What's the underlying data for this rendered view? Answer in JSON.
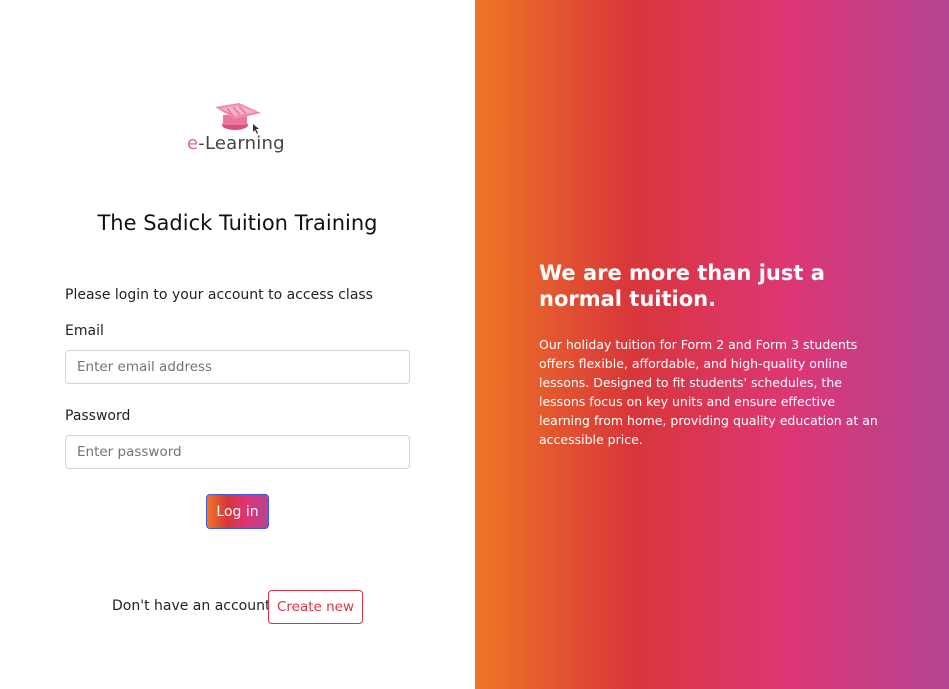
{
  "logo": {
    "prefix": "e",
    "suffix": "-Learning"
  },
  "title": "The Sadick Tuition Training",
  "login_form": {
    "subtitle": "Please login to your account to access class",
    "email_label": "Email",
    "email_placeholder": "Enter email address",
    "password_label": "Password",
    "password_placeholder": "Enter password",
    "login_button": "Log in"
  },
  "signup": {
    "prompt": "Don't have an account?",
    "create_button": "Create new"
  },
  "promo": {
    "headline": "We are more than just a normal tuition.",
    "body": "Our holiday tuition for Form 2 and Form 3 students offers flexible, affordable, and high-quality online lessons. Designed to fit students' schedules, the lessons focus on key units and ensure effective learning from home, providing quality education at an accessible price."
  },
  "colors": {
    "gradient": [
      "#ee7724",
      "#d8363a",
      "#dd3675",
      "#b44593"
    ],
    "create_button": "#dc3545",
    "logo_pink": "#e36a8e"
  },
  "icons": {
    "logo_icon": "graduation-cap-icon"
  }
}
